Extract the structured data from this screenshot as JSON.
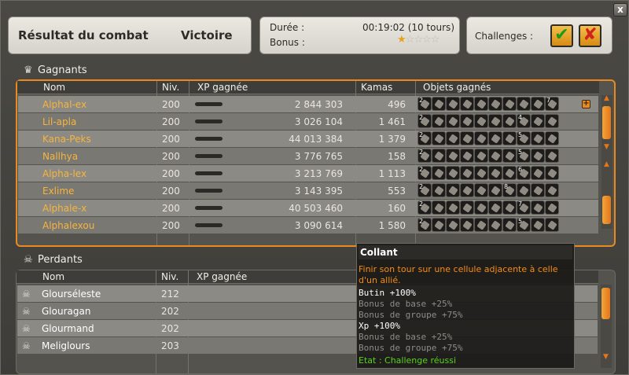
{
  "header": {
    "title": "Résultat du combat",
    "result": "Victoire",
    "duration_label": "Durée :",
    "duration_value": "00:19:02 (10 tours)",
    "bonus_label": "Bonus :",
    "bonus_stars": 1,
    "bonus_stars_max": 5,
    "challenges_label": "Challenges :",
    "challenge_icons": [
      "check-icon",
      "cross-icon"
    ],
    "close_glyph": "x"
  },
  "winners": {
    "title": "Gagnants",
    "columns": [
      "Nom",
      "Niv.",
      "XP gagnée",
      "Kamas",
      "Objets gagnés"
    ],
    "rows": [
      {
        "name": "Alphal-ex",
        "level": "200",
        "xp": "2 844 303",
        "kamas": "496",
        "items": [
          "2",
          "",
          "",
          "",
          "",
          "",
          "",
          "",
          "",
          "7"
        ]
      },
      {
        "name": "Lil-apla",
        "level": "200",
        "xp": "3 026 104",
        "kamas": "1 461",
        "items": [
          "2",
          "",
          "",
          "",
          "",
          "",
          "",
          "4",
          "",
          ""
        ]
      },
      {
        "name": "Kana-Peks",
        "level": "200",
        "xp": "44 013 384",
        "kamas": "1 379",
        "items": [
          "2",
          "",
          "",
          "",
          "",
          "",
          "",
          "5",
          "",
          ""
        ]
      },
      {
        "name": "Nallhya",
        "level": "200",
        "xp": "3 776 765",
        "kamas": "158",
        "items": [
          "2",
          "",
          "",
          "",
          "",
          "",
          "",
          "5",
          "",
          ""
        ]
      },
      {
        "name": "Alpha-lex",
        "level": "200",
        "xp": "3 213 769",
        "kamas": "1 113",
        "items": [
          "2",
          "",
          "",
          "",
          "",
          "",
          "",
          "6",
          "",
          ""
        ]
      },
      {
        "name": "Exlime",
        "level": "200",
        "xp": "3 143 395",
        "kamas": "553",
        "items": [
          "2",
          "",
          "",
          "",
          "",
          "",
          "8",
          "",
          "",
          ""
        ]
      },
      {
        "name": "Alphale-x",
        "level": "200",
        "xp": "40 503 460",
        "kamas": "160",
        "items": [
          "2",
          "",
          "",
          "",
          "",
          "",
          "",
          "7",
          "",
          ""
        ]
      },
      {
        "name": "Alphalexou",
        "level": "200",
        "xp": "3 090 614",
        "kamas": "1 580",
        "items": [
          "2",
          "",
          "",
          "",
          "",
          "",
          "",
          "5",
          "",
          ""
        ]
      }
    ]
  },
  "losers": {
    "title": "Perdants",
    "columns": [
      "Nom",
      "Niv.",
      "XP gagnée"
    ],
    "rows": [
      {
        "name": "Glourséleste",
        "level": "212"
      },
      {
        "name": "Glouragan",
        "level": "202"
      },
      {
        "name": "Glourmand",
        "level": "202"
      },
      {
        "name": "Meliglours",
        "level": "203"
      }
    ]
  },
  "tooltip": {
    "title": "Collant",
    "description": "Finir son tour sur une cellule adjacente à celle d'un allié.",
    "lines": [
      {
        "text": "Butin +100%",
        "style": "strong"
      },
      {
        "text": "Bonus de base +25%",
        "style": "dim"
      },
      {
        "text": "Bonus de groupe +75%",
        "style": "dim"
      },
      {
        "text": "Xp +100%",
        "style": "strong"
      },
      {
        "text": "Bonus de base +25%",
        "style": "dim"
      },
      {
        "text": "Bonus de groupe +75%",
        "style": "dim"
      }
    ],
    "status": "Etat : Challenge réussi"
  },
  "colors": {
    "accent_orange": "#e88a1f",
    "winner_name": "#f7b53c",
    "success_green": "#59d21c"
  }
}
